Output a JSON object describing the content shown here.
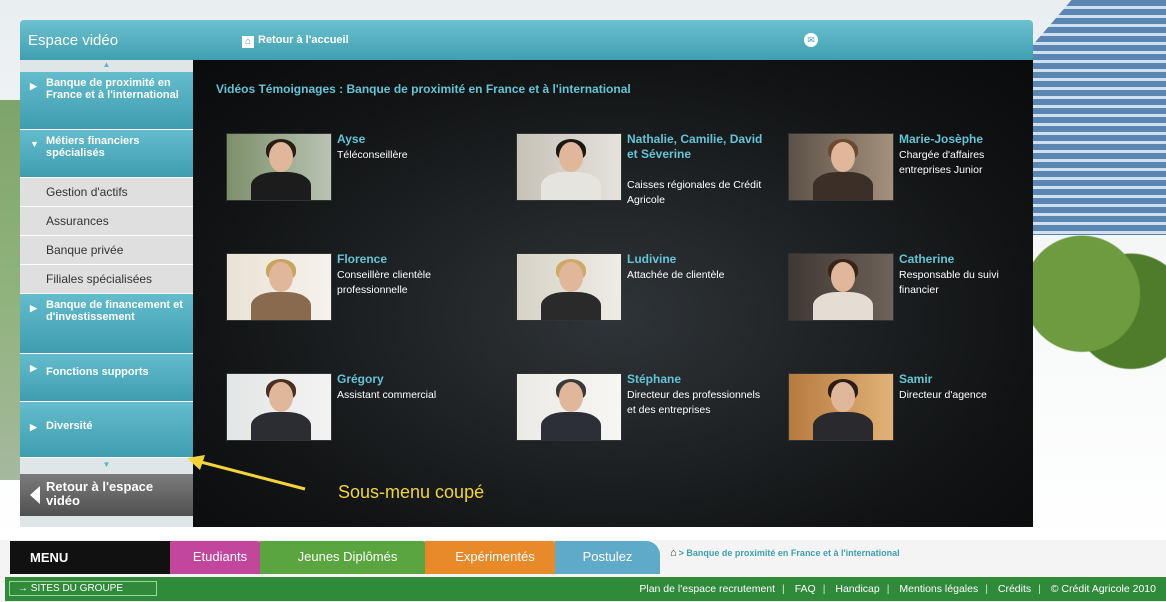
{
  "header": {
    "title": "Espace vidéo",
    "home_link": "Retour à l'accueil"
  },
  "sidebar": {
    "categories": [
      {
        "label": "Banque de proximité en France et à l'international"
      },
      {
        "label": "Métiers financiers spécialisés"
      },
      {
        "label": "Banque de financement et d'investissement"
      },
      {
        "label": "Fonctions supports"
      },
      {
        "label": "Diversité"
      }
    ],
    "subitems": [
      "Gestion d'actifs",
      "Assurances",
      "Banque privée",
      "Filiales spécialisées"
    ],
    "back_label": "Retour à l'espace vidéo"
  },
  "content": {
    "title": "Vidéos Témoignages : Banque de proximité en France et à l'international",
    "videos": [
      {
        "name": "Ayse",
        "role": "Téléconseillère"
      },
      {
        "name": "Nathalie, Camilie, David et Séverine",
        "role": "Caisses régionales de Crédit Agricole"
      },
      {
        "name": "Marie-Josèphe",
        "role": "Chargée d'affaires entreprises Junior"
      },
      {
        "name": "Florence",
        "role": "Conseillère clientèle professionnelle"
      },
      {
        "name": "Ludivine",
        "role": "Attachée de clientèle"
      },
      {
        "name": "Catherine",
        "role": "Responsable du suivi financier"
      },
      {
        "name": "Grégory",
        "role": "Assistant commercial"
      },
      {
        "name": "Stéphane",
        "role": "Directeur des professionnels et des entreprises"
      },
      {
        "name": "Samir",
        "role": "Directeur d'agence"
      }
    ]
  },
  "annotation": {
    "text": "Sous-menu coupé"
  },
  "menubar": {
    "label": "MENU",
    "tabs": [
      {
        "label": "Etudiants",
        "color": "#c2479c"
      },
      {
        "label": "Jeunes Diplômés",
        "color": "#5aa53f"
      },
      {
        "label": "Expérimentés",
        "color": "#e8892a"
      },
      {
        "label": "Postulez",
        "color": "#5fa9c9"
      }
    ],
    "breadcrumb": "> Banque de proximité en France et à l'international"
  },
  "footer": {
    "sites_button": "→ SITES DU GROUPE",
    "links": [
      "Plan de l'espace recrutement",
      "FAQ",
      "Handicap",
      "Mentions légales",
      "Crédits",
      "© Crédit Agricole 2010"
    ]
  }
}
